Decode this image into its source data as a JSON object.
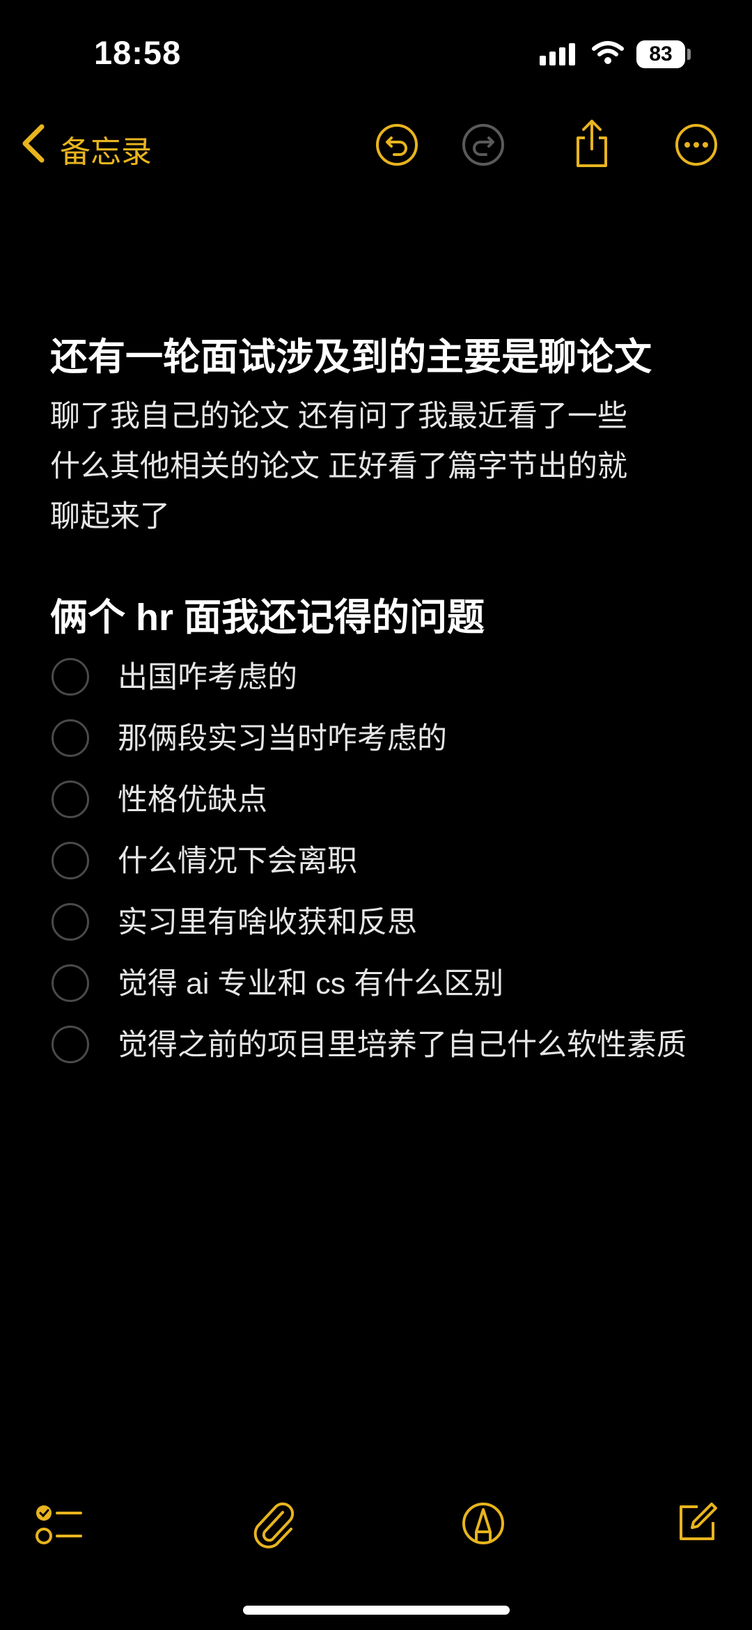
{
  "status_bar": {
    "time": "18:58",
    "battery": "83"
  },
  "nav": {
    "back_label": "备忘录"
  },
  "note": {
    "heading1": "还有一轮面试涉及到的主要是聊论文",
    "paragraph_lines": [
      "聊了我自己的论文 还有问了我最近看了一些",
      "什么其他相关的论文 正好看了篇字节出的就",
      "聊起来了"
    ],
    "heading2": "俩个 hr 面我还记得的问题",
    "checklist": [
      "出国咋考虑的",
      "那俩段实习当时咋考虑的",
      "性格优缺点",
      "什么情况下会离职",
      "实习里有啥收获和反思",
      "觉得 ai 专业和 cs 有什么区别",
      "觉得之前的项目里培养了自己什么软性素质"
    ]
  },
  "colors": {
    "accent": "#e8b41e",
    "background": "#000000",
    "checkbox": "#4a4a4a"
  },
  "icons": {
    "back": "chevron-left-icon",
    "undo": "undo-icon",
    "redo": "redo-icon",
    "share": "share-icon",
    "more": "ellipsis-icon",
    "checklist": "checklist-icon",
    "attach": "paperclip-icon",
    "markup": "markup-pen-icon",
    "compose": "compose-icon"
  }
}
